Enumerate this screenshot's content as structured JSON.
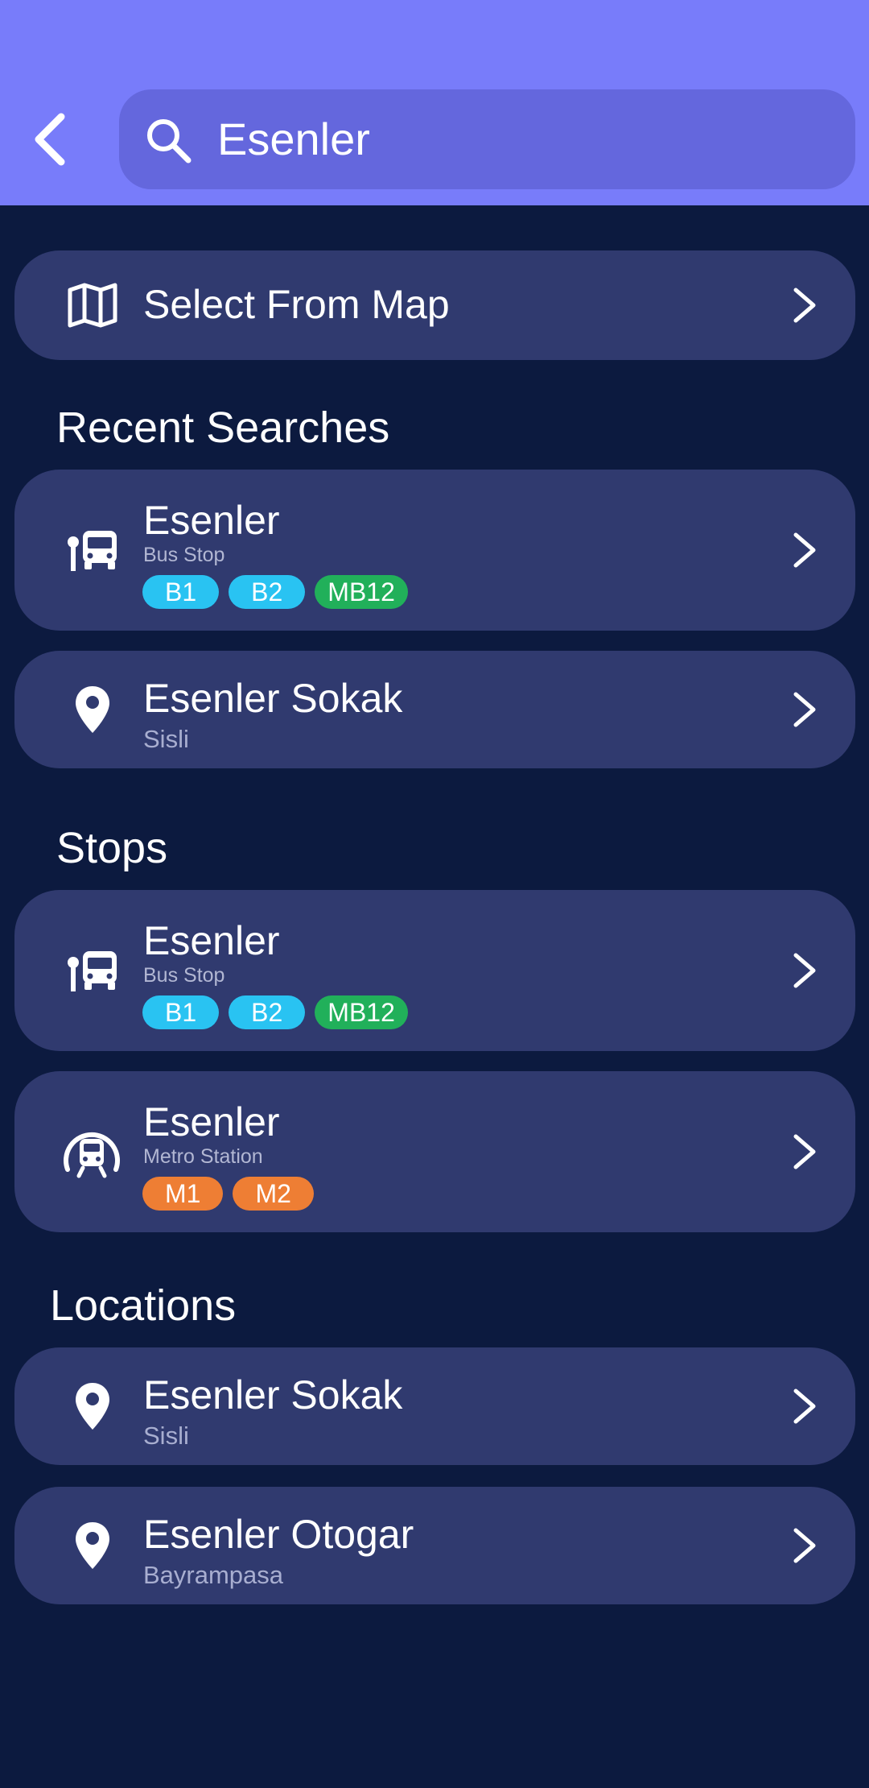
{
  "header": {
    "search_value": "Esenler"
  },
  "select_from_map": {
    "label": "Select From Map"
  },
  "recent_searches": {
    "title": "Recent Searches",
    "items": [
      {
        "name": "Esenler",
        "type": "Bus Stop",
        "icon": "bus-stop-icon",
        "lines": [
          {
            "label": "B1",
            "color": "#29c3f2"
          },
          {
            "label": "B2",
            "color": "#29c3f2"
          },
          {
            "label": "MB12",
            "color": "#21b05a"
          }
        ]
      },
      {
        "name": "Esenler Sokak",
        "subtitle": "Sisli",
        "icon": "location-pin-icon"
      }
    ]
  },
  "stops": {
    "title": "Stops",
    "items": [
      {
        "name": "Esenler",
        "type": "Bus Stop",
        "icon": "bus-stop-icon",
        "lines": [
          {
            "label": "B1",
            "color": "#29c3f2"
          },
          {
            "label": "B2",
            "color": "#29c3f2"
          },
          {
            "label": "MB12",
            "color": "#21b05a"
          }
        ]
      },
      {
        "name": "Esenler",
        "type": "Metro Station",
        "icon": "metro-station-icon",
        "lines": [
          {
            "label": "M1",
            "color": "#ee7e34"
          },
          {
            "label": "M2",
            "color": "#ee7e34"
          }
        ]
      }
    ]
  },
  "locations": {
    "title": "Locations",
    "items": [
      {
        "name": "Esenler Sokak",
        "subtitle": "Sisli",
        "icon": "location-pin-icon"
      },
      {
        "name": "Esenler Otogar",
        "subtitle": "Bayrampasa",
        "icon": "location-pin-icon"
      }
    ]
  },
  "colors": {
    "header_bg": "#787cfa",
    "search_bg": "#6467dd",
    "page_bg": "#0c1a3f",
    "card_bg": "#303a6f"
  }
}
